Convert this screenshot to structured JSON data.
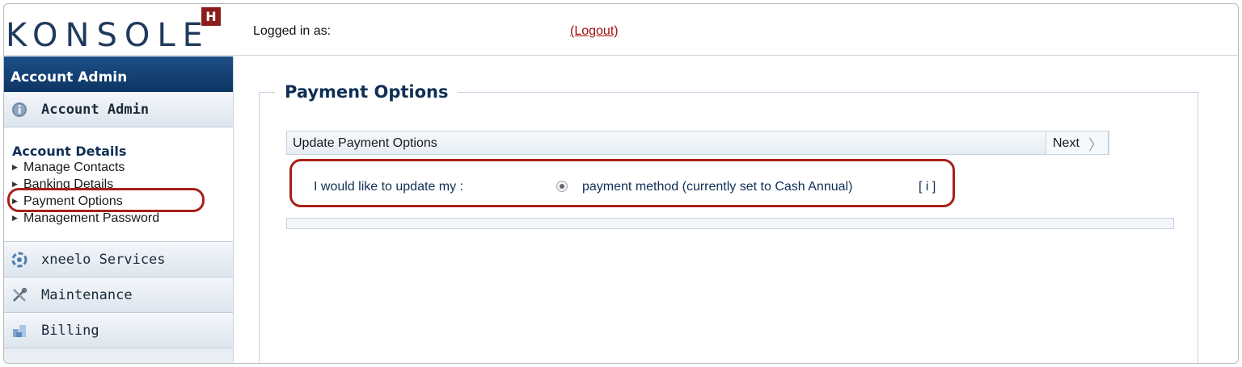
{
  "header": {
    "logo_text": "KONSOLE",
    "logo_badge": "H",
    "logged_in_label": "Logged in as:",
    "logout_label": "(Logout)"
  },
  "sidebar": {
    "title": "Account Admin",
    "sections": [
      {
        "label": "Account Admin",
        "icon": "info-icon",
        "active": true
      },
      {
        "label": "xneelo Services",
        "icon": "gear-services-icon"
      },
      {
        "label": "Maintenance",
        "icon": "tools-icon"
      },
      {
        "label": "Billing",
        "icon": "billing-icon"
      }
    ],
    "subheading": "Account Details",
    "links": [
      "Manage Contacts",
      "Banking Details",
      "Payment Options",
      "Management Password"
    ]
  },
  "main": {
    "page_title": "Payment Options",
    "tab_title": "Update Payment Options",
    "next_label": "Next",
    "question": "I would like to update my :",
    "option_label": "payment method (currently set to Cash Annual)",
    "info_label": "[ i ]"
  },
  "colors": {
    "brand_navy": "#0f2f55",
    "logo_badge": "#8b1c1c",
    "logout_red": "#a01010",
    "highlight": "#a8201a"
  }
}
